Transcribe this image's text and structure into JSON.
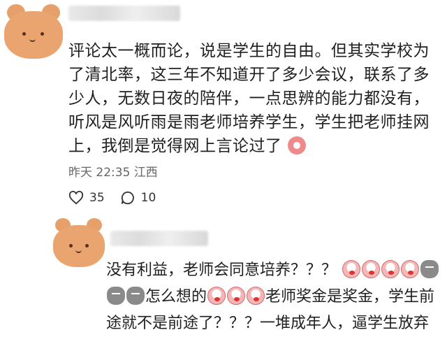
{
  "comment1": {
    "text": "评论太一概而论，说是学生的自由。但其实学校为了清北率，这三年不知道开了多少会议，联系了多少人，无数日夜的陪伴，一点思辨的能力都没有，听风是风听雨是雨老师培养学生，学生把老师挂网上，我倒是觉得网上言论过了",
    "emoji": "sad-face-emoji",
    "time": "昨天 22:35",
    "location": "江西",
    "likes": "35",
    "replies": "10"
  },
  "comment2": {
    "line1": "没有利益，老师会同意培养？？？",
    "line2a": "怎么想的",
    "line2b": "老师奖金是奖金，学生前",
    "line3": "途就不是前途了？？？一堆成年人，逼学生放弃"
  },
  "colors": {
    "avatar": "#eaa470",
    "meta": "#666666",
    "text": "#1f1f1f"
  },
  "icons": [
    "bear-avatar",
    "heart-icon",
    "comment-bubble-icon",
    "crying-emoji",
    "grey-face-emoji"
  ]
}
